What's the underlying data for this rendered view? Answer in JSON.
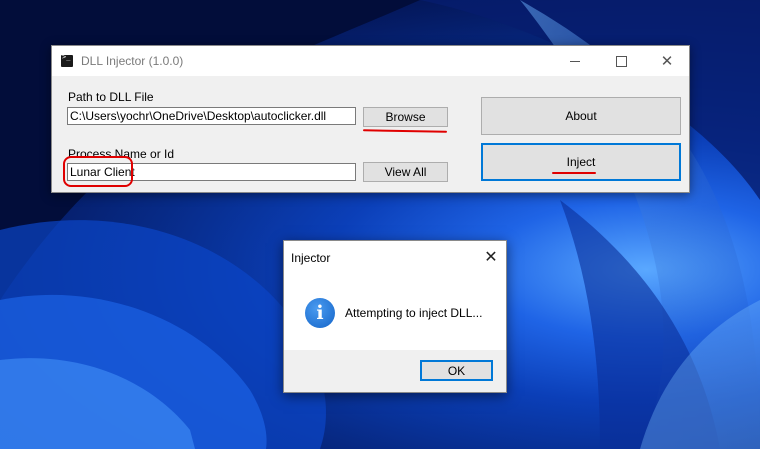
{
  "window": {
    "title": "DLL Injector (1.0.0)",
    "path_label": "Path to DLL File",
    "path_value": "C:\\Users\\yochr\\OneDrive\\Desktop\\autoclicker.dll",
    "browse_label": "Browse",
    "process_label": "Process Name or Id",
    "process_value": "Lunar Client",
    "view_all_label": "View All",
    "about_label": "About",
    "inject_label": "Inject"
  },
  "dialog": {
    "title": "Injector",
    "message": "Attempting to inject DLL...",
    "ok_label": "OK"
  },
  "icons": {
    "app": "console-icon",
    "info": "info-icon",
    "close": "close-icon"
  },
  "colors": {
    "annotation": "#e00000",
    "focus": "#0078d7",
    "info": "#1464c8"
  }
}
